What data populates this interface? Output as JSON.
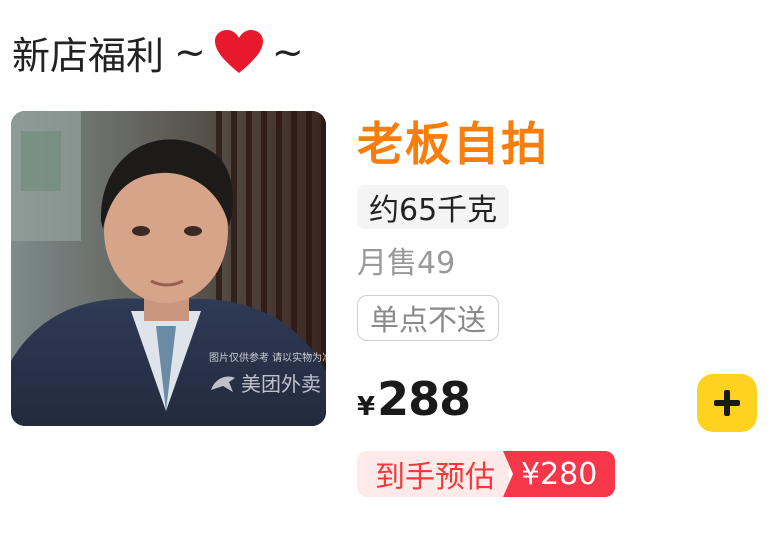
{
  "section": {
    "title": "新店福利",
    "tilde_left": "~",
    "tilde_right": "~",
    "heart_icon": "heart-icon"
  },
  "product": {
    "name": "老板自拍",
    "spec": "约65千克",
    "monthly_sales": "月售49",
    "delivery_note": "单点不送",
    "currency": "¥",
    "price": "288",
    "estimate_label": "到手预估",
    "estimate_price": "¥280",
    "image_watermark_note": "图片仅供参考 请以实物为准",
    "image_watermark_brand": "美团外卖"
  },
  "colors": {
    "name_orange": "#f97d0b",
    "add_button_yellow": "#ffd21f",
    "estimate_red": "#f6374a",
    "heart_red": "#e8192c"
  }
}
